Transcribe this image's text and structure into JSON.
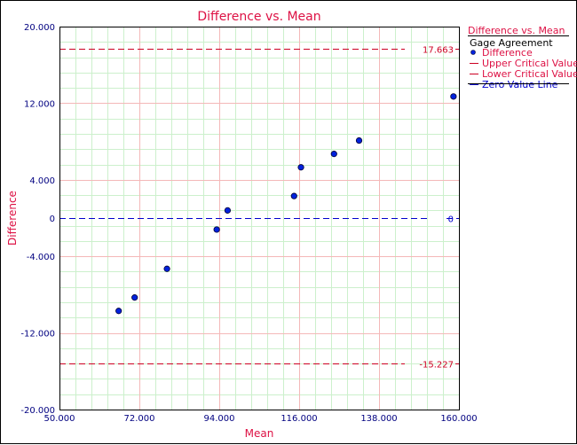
{
  "chart_data": {
    "type": "scatter",
    "title": "Difference vs. Mean",
    "xlabel": "Mean",
    "ylabel": "Difference",
    "xlim": [
      50,
      160
    ],
    "ylim": [
      -20,
      20
    ],
    "xticks": [
      50,
      72,
      94,
      116,
      138,
      160
    ],
    "xtick_labels": [
      "50.000",
      "72.000",
      "94.000",
      "116.000",
      "138.000",
      "160.000"
    ],
    "yticks": [
      20,
      12,
      4,
      0,
      -4,
      -12,
      -20
    ],
    "ytick_labels": [
      "20.000",
      "12.000",
      "4.000",
      "0",
      "-4.000",
      "-12.000",
      "-20.000"
    ],
    "grid": true,
    "series": [
      {
        "name": "Difference",
        "points": [
          {
            "x": 66.3,
            "y": -9.7
          },
          {
            "x": 70.7,
            "y": -8.3
          },
          {
            "x": 79.6,
            "y": -5.3
          },
          {
            "x": 93.3,
            "y": -1.2
          },
          {
            "x": 96.3,
            "y": 0.8
          },
          {
            "x": 114.6,
            "y": 2.3
          },
          {
            "x": 116.5,
            "y": 5.3
          },
          {
            "x": 125.6,
            "y": 6.7
          },
          {
            "x": 132.5,
            "y": 8.1
          },
          {
            "x": 158.5,
            "y": 12.7
          }
        ]
      }
    ],
    "reference_lines": [
      {
        "name": "Upper Critical Value",
        "y": 17.663,
        "label": "17.663",
        "color": "#cc0022",
        "style": "dashed"
      },
      {
        "name": "Lower Critical Value",
        "y": -15.227,
        "label": "-15.227",
        "color": "#cc0022",
        "style": "dashed"
      },
      {
        "name": "Zero Value Line",
        "y": 0,
        "label": "0",
        "color": "#0000cc",
        "style": "dashed"
      }
    ],
    "legend": {
      "placement": "right",
      "title": "Difference vs. Mean",
      "subtitle": "Gage Agreement",
      "items": [
        "Difference",
        "Upper Critical Value",
        "Lower Critical Value",
        "Zero Value Line"
      ]
    }
  },
  "colors": {
    "title": "#dd1144",
    "tick_text": "#000080",
    "major_grid": "#f4b8b8",
    "minor_grid": "#ccf0cc",
    "point_fill": "#0022dd",
    "critical": "#cc0022",
    "zero": "#0000cc"
  }
}
